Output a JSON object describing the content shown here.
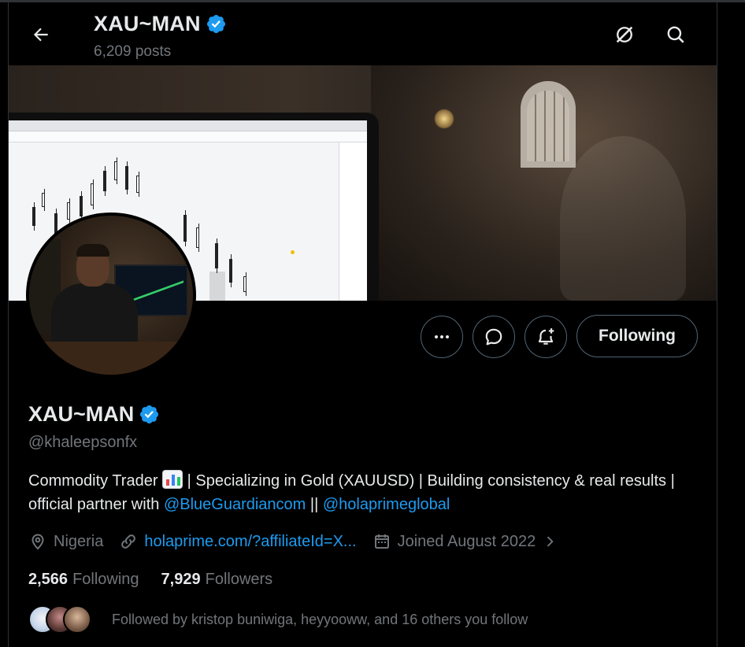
{
  "header": {
    "title": "XAU~MAN",
    "posts_count": "6,209 posts"
  },
  "profile": {
    "display_name": "XAU~MAN",
    "handle": "@khaleepsonfx",
    "bio_part1": "Commodity Trader",
    "bio_part2": " | Specializing in Gold (XAUUSD) | Building consistency & real results | official partner with ",
    "bio_mention1": "@BlueGuardiancom",
    "bio_sep": " || ",
    "bio_mention2": "@holaprimeglobal",
    "location": "Nigeria",
    "website": "holaprime.com/?affiliateId=X...",
    "joined": "Joined August 2022",
    "following_count": "2,566",
    "following_label": "Following",
    "followers_count": "7,929",
    "followers_label": "Followers",
    "followed_by": "Followed by kristop buniwiga, heyyooww, and 16 others you follow"
  },
  "actions": {
    "following_button": "Following"
  },
  "colors": {
    "accent": "#1d9bf0",
    "muted": "#71767b",
    "text": "#e7e9ea",
    "border": "#536471",
    "background": "#000000"
  },
  "icons": {
    "back": "arrow-left-icon",
    "grok": "grok-slash-icon",
    "search": "search-icon",
    "verified": "verified-badge-icon",
    "more": "more-dots-icon",
    "message": "message-bubble-icon",
    "notify": "bell-plus-icon",
    "location": "location-pin-icon",
    "link": "link-icon",
    "calendar": "calendar-icon",
    "chevron": "chevron-right-icon"
  }
}
